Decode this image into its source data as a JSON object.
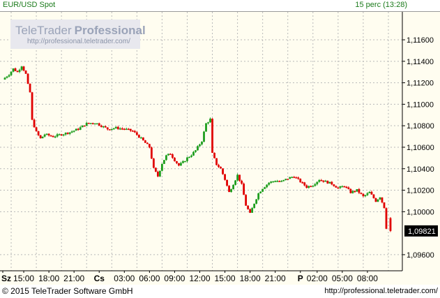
{
  "header": {
    "instrument": "EUR/USD Spot",
    "interval": "15 perc (13:28)"
  },
  "watermark": {
    "brand_light": "TeleTrader",
    "brand_bold": "Professional",
    "url": "http://professional.teletrader.com/"
  },
  "footer": {
    "copyright": "© 2015 TeleTrader Software GmbH",
    "url": "http://professional.teletrader.com/"
  },
  "chart_data": {
    "type": "candlestick",
    "grid": true,
    "ylim": [
      1.0945,
      1.1186
    ],
    "y_ticks": [
      "1,11600",
      "1,11400",
      "1,11200",
      "1,11000",
      "1,10800",
      "1,10600",
      "1,10400",
      "1,10200",
      "1,10000",
      "1,09600"
    ],
    "y_tick_values": [
      1.116,
      1.114,
      1.112,
      1.11,
      1.108,
      1.106,
      1.104,
      1.102,
      1.1,
      1.096
    ],
    "last_price": "1,09821",
    "last_price_value": 1.09821,
    "x_range": [
      0,
      187
    ],
    "x_labels": [
      {
        "label": "Sz",
        "x": 0,
        "bold": true
      },
      {
        "label": "15:00",
        "x": 10
      },
      {
        "label": "18:00",
        "x": 22
      },
      {
        "label": "21:00",
        "x": 34
      },
      {
        "label": "Cs",
        "x": 46,
        "bold": true
      },
      {
        "label": "03:00",
        "x": 58
      },
      {
        "label": "06:00",
        "x": 70
      },
      {
        "label": "09:00",
        "x": 82
      },
      {
        "label": "12:00",
        "x": 94
      },
      {
        "label": "15:00",
        "x": 106
      },
      {
        "label": "18:00",
        "x": 118
      },
      {
        "label": "21:00",
        "x": 130
      },
      {
        "label": "P",
        "x": 142,
        "bold": true
      },
      {
        "label": "02:00",
        "x": 150
      },
      {
        "label": "05:00",
        "x": 162
      },
      {
        "label": "08:00",
        "x": 174
      }
    ],
    "x_grid": [
      4,
      16,
      28,
      40,
      52,
      64,
      76,
      88,
      100,
      112,
      124,
      136,
      148,
      160,
      172,
      184
    ],
    "up_color": "#1e9e1e",
    "down_color": "#e00000",
    "anchors": [
      [
        0,
        1.1123
      ],
      [
        3,
        1.1128
      ],
      [
        5,
        1.1133
      ],
      [
        7,
        1.113
      ],
      [
        9,
        1.1136
      ],
      [
        11,
        1.1128
      ],
      [
        12,
        1.1118
      ],
      [
        13,
        1.1111
      ],
      [
        14,
        1.1085
      ],
      [
        16,
        1.1074
      ],
      [
        18,
        1.1068
      ],
      [
        20,
        1.1072
      ],
      [
        24,
        1.107
      ],
      [
        28,
        1.1072
      ],
      [
        32,
        1.1074
      ],
      [
        36,
        1.1077
      ],
      [
        40,
        1.1082
      ],
      [
        44,
        1.1083
      ],
      [
        47,
        1.108
      ],
      [
        50,
        1.1077
      ],
      [
        54,
        1.1078
      ],
      [
        58,
        1.1077
      ],
      [
        62,
        1.1075
      ],
      [
        65,
        1.107
      ],
      [
        68,
        1.1064
      ],
      [
        70,
        1.106
      ],
      [
        72,
        1.104
      ],
      [
        74,
        1.1033
      ],
      [
        76,
        1.1045
      ],
      [
        78,
        1.1052
      ],
      [
        80,
        1.1054
      ],
      [
        82,
        1.1048
      ],
      [
        84,
        1.1043
      ],
      [
        86,
        1.1046
      ],
      [
        88,
        1.105
      ],
      [
        90,
        1.1053
      ],
      [
        92,
        1.1057
      ],
      [
        95,
        1.1066
      ],
      [
        97,
        1.1082
      ],
      [
        99,
        1.1086
      ],
      [
        100,
        1.1054
      ],
      [
        102,
        1.1044
      ],
      [
        104,
        1.104
      ],
      [
        106,
        1.103
      ],
      [
        108,
        1.1018
      ],
      [
        110,
        1.1026
      ],
      [
        112,
        1.1034
      ],
      [
        114,
        1.1025
      ],
      [
        116,
        1.1006
      ],
      [
        118,
        1.0998
      ],
      [
        120,
        1.1008
      ],
      [
        122,
        1.1017
      ],
      [
        124,
        1.1022
      ],
      [
        127,
        1.1027
      ],
      [
        130,
        1.1029
      ],
      [
        133,
        1.1028
      ],
      [
        136,
        1.1031
      ],
      [
        139,
        1.1033
      ],
      [
        142,
        1.1028
      ],
      [
        145,
        1.1023
      ],
      [
        148,
        1.1025
      ],
      [
        151,
        1.103
      ],
      [
        154,
        1.1028
      ],
      [
        157,
        1.1026
      ],
      [
        160,
        1.1022
      ],
      [
        163,
        1.1024
      ],
      [
        166,
        1.1018
      ],
      [
        169,
        1.102
      ],
      [
        172,
        1.1014
      ],
      [
        175,
        1.1018
      ],
      [
        178,
        1.101
      ],
      [
        180,
        1.1014
      ],
      [
        182,
        1.1004
      ],
      [
        183,
        1.0985
      ]
    ]
  }
}
